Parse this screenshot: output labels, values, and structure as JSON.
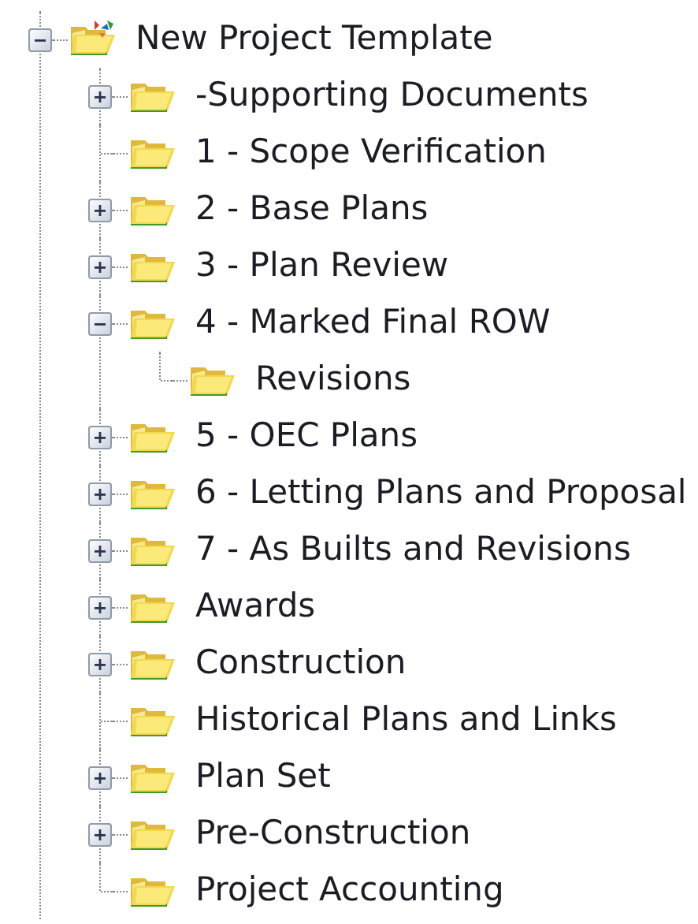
{
  "tree": [
    {
      "label": "New Project Template",
      "kind": "template",
      "expandable": true,
      "expanded": true,
      "children": [
        {
          "label": "-Supporting Documents",
          "kind": "folder",
          "expandable": true,
          "expanded": false
        },
        {
          "label": "1 - Scope Verification",
          "kind": "folder",
          "expandable": false
        },
        {
          "label": "2 - Base Plans",
          "kind": "folder",
          "expandable": true,
          "expanded": false
        },
        {
          "label": "3 - Plan Review",
          "kind": "folder",
          "expandable": true,
          "expanded": false
        },
        {
          "label": "4 - Marked Final ROW",
          "kind": "folder",
          "expandable": true,
          "expanded": true,
          "children": [
            {
              "label": "Revisions",
              "kind": "folder",
              "expandable": false
            }
          ]
        },
        {
          "label": "5 - OEC Plans",
          "kind": "folder",
          "expandable": true,
          "expanded": false
        },
        {
          "label": "6 - Letting Plans and Proposal",
          "kind": "folder",
          "expandable": true,
          "expanded": false
        },
        {
          "label": "7 - As Builts and Revisions",
          "kind": "folder",
          "expandable": true,
          "expanded": false
        },
        {
          "label": "Awards",
          "kind": "folder",
          "expandable": true,
          "expanded": false
        },
        {
          "label": "Construction",
          "kind": "folder",
          "expandable": true,
          "expanded": false
        },
        {
          "label": "Historical Plans and Links",
          "kind": "folder",
          "expandable": false
        },
        {
          "label": "Plan Set",
          "kind": "folder",
          "expandable": true,
          "expanded": false
        },
        {
          "label": "Pre-Construction",
          "kind": "folder",
          "expandable": true,
          "expanded": false
        },
        {
          "label": "Project Accounting",
          "kind": "folder",
          "expandable": false
        }
      ]
    }
  ]
}
